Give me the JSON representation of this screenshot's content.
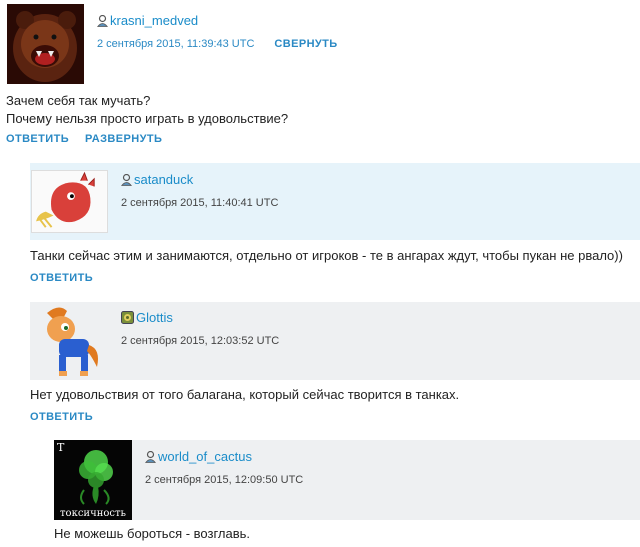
{
  "comments": [
    {
      "username": "krasni_medved",
      "user_icon": "user-icon",
      "date": "2 сентября 2015, 11:39:43 UTC",
      "toggle": "СВЕРНУТЬ",
      "text_lines": [
        "Зачем себя так мучать?",
        "Почему нельзя просто играть в удовольствие?"
      ],
      "reply": "ОТВЕТИТЬ",
      "expand": "РАЗВЕРНУТЬ"
    },
    {
      "username": "satanduck",
      "user_icon": "user-icon",
      "date": "2 сентября 2015, 11:40:41 UTC",
      "text": "Танки сейчас этим и занимаются, отдельно от игроков - те в ангарах ждут, чтобы пукан не рвало))",
      "reply": "ОТВЕТИТЬ"
    },
    {
      "username": "Glottis",
      "user_icon": "clan-badge-icon",
      "date": "2 сентября 2015, 12:03:52 UTC",
      "text": "Нет удовольствия от того балагана, который сейчас творится в танках.",
      "reply": "ОТВЕТИТЬ"
    },
    {
      "username": "world_of_cactus",
      "user_icon": "user-icon",
      "date": "2 сентября 2015, 12:09:50 UTC",
      "avatar_caption_top": "T",
      "avatar_caption_bottom": "токсичность",
      "text": "Не можешь бороться - возглавь."
    }
  ],
  "colors": {
    "link": "#2a89c4",
    "username": "#1a8cc9",
    "header_blue": "#e6f3fa",
    "header_grey": "#eef0f2"
  }
}
